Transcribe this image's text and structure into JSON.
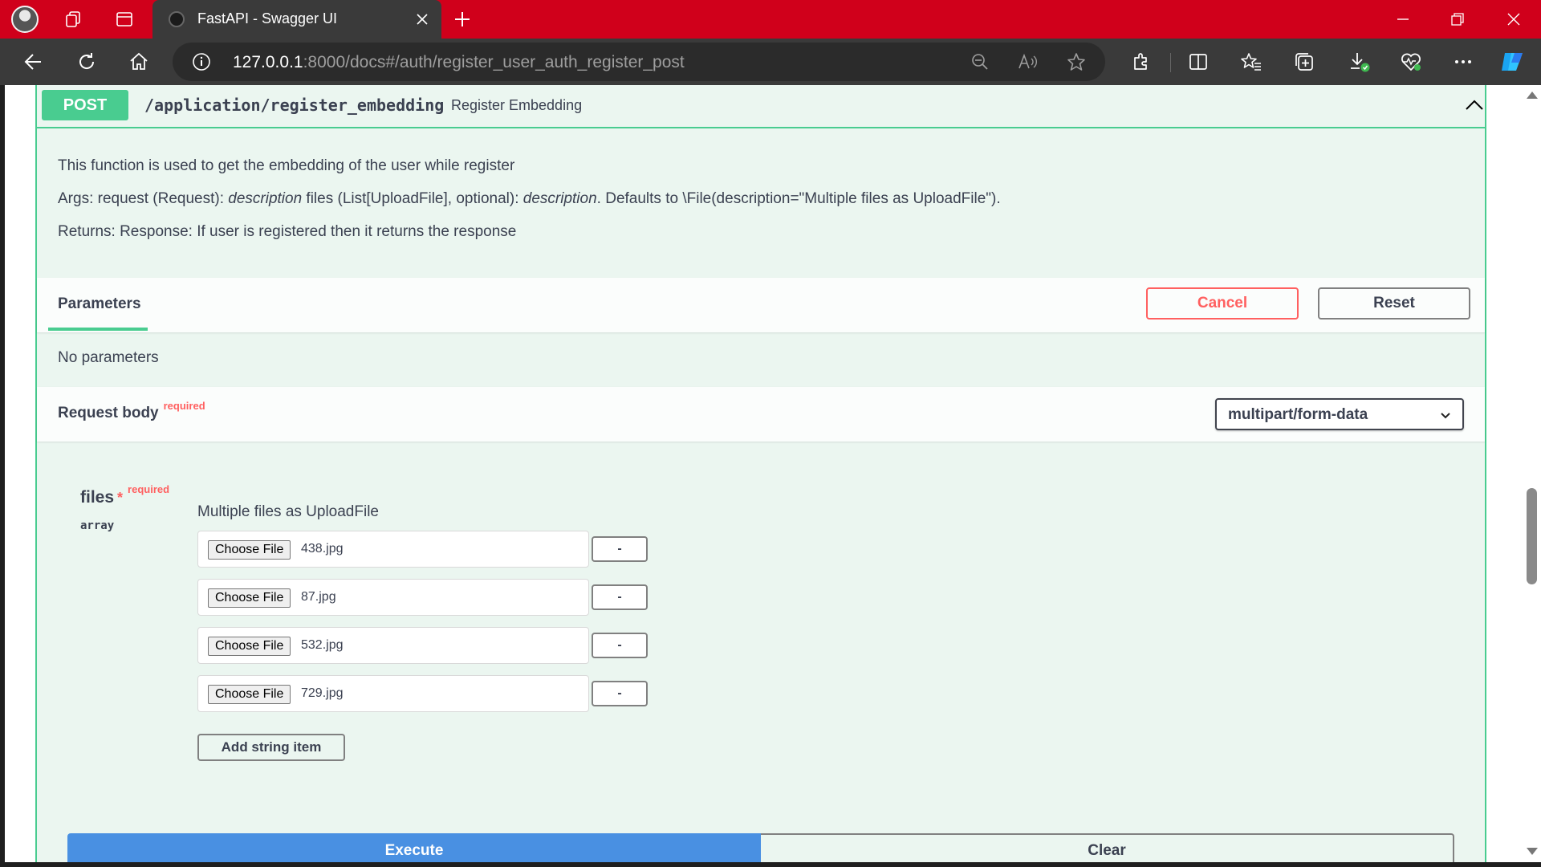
{
  "browser": {
    "tab_title": "FastAPI - Swagger UI",
    "url_host": "127.0.0.1",
    "url_rest": ":8000/docs#/auth/register_user_auth_register_post"
  },
  "operation": {
    "method": "POST",
    "path": "/application/register_embedding",
    "summary": "Register Embedding",
    "description_line1": "This function is used to get the embedding of the user while register",
    "description_line2": {
      "prefix": "Args: request (Request): ",
      "em1": "description",
      "mid": " files (List[UploadFile], optional): ",
      "em2": "description",
      "suffix": ". Defaults to \\File(description=\"Multiple files as UploadFile\")."
    },
    "description_line3": "Returns: Response: If user is registered then it returns the response"
  },
  "parameters": {
    "title": "Parameters",
    "cancel_label": "Cancel",
    "reset_label": "Reset",
    "empty_text": "No parameters"
  },
  "request_body": {
    "title": "Request body",
    "required_label": "required",
    "content_type": "multipart/form-data",
    "field": {
      "name": "files",
      "star": "*",
      "required_label": "required",
      "type": "array",
      "description": "Multiple files as UploadFile"
    },
    "files": [
      {
        "button": "Choose File",
        "filename": "438.jpg",
        "remove": "-"
      },
      {
        "button": "Choose File",
        "filename": "87.jpg",
        "remove": "-"
      },
      {
        "button": "Choose File",
        "filename": "532.jpg",
        "remove": "-"
      },
      {
        "button": "Choose File",
        "filename": "729.jpg",
        "remove": "-"
      }
    ],
    "add_item_label": "Add string item"
  },
  "actions": {
    "execute_label": "Execute",
    "clear_label": "Clear"
  },
  "colors": {
    "post_green": "#49cc90",
    "block_bg": "#ebf6f0",
    "cancel_red": "#ff6060",
    "execute_blue": "#4990e2",
    "titlebar_red": "#d0001b"
  }
}
